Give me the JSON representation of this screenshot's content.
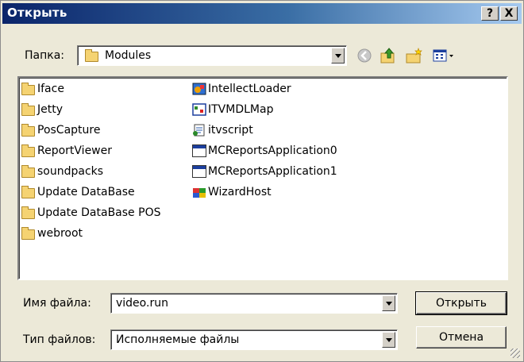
{
  "window": {
    "title": "Открыть",
    "help_button": "?",
    "close_button": "X"
  },
  "location": {
    "label": "Папка:",
    "value": "Modules"
  },
  "toolbar": {
    "back": "back-icon",
    "up": "up-folder-icon",
    "new_folder": "new-folder-icon",
    "view": "view-menu-icon"
  },
  "files": {
    "folders": [
      "Iface",
      "Jetty",
      "PosCapture",
      "ReportViewer",
      "soundpacks",
      "Update DataBase",
      "Update DataBase POS",
      "webroot"
    ],
    "programs": [
      "IntellectLoader",
      "ITVMDLMap",
      "itvscript",
      "MCReportsApplication0",
      "MCReportsApplication1",
      "WizardHost"
    ]
  },
  "filename": {
    "label": "Имя файла:",
    "value": "video.run"
  },
  "filetype": {
    "label": "Тип файлов:",
    "value": "Исполняемые файлы"
  },
  "buttons": {
    "open": "Открыть",
    "cancel": "Отмена"
  },
  "colors": {
    "title_start": "#0a246a",
    "title_end": "#a6caf0",
    "dialog_bg": "#ece9d8"
  }
}
